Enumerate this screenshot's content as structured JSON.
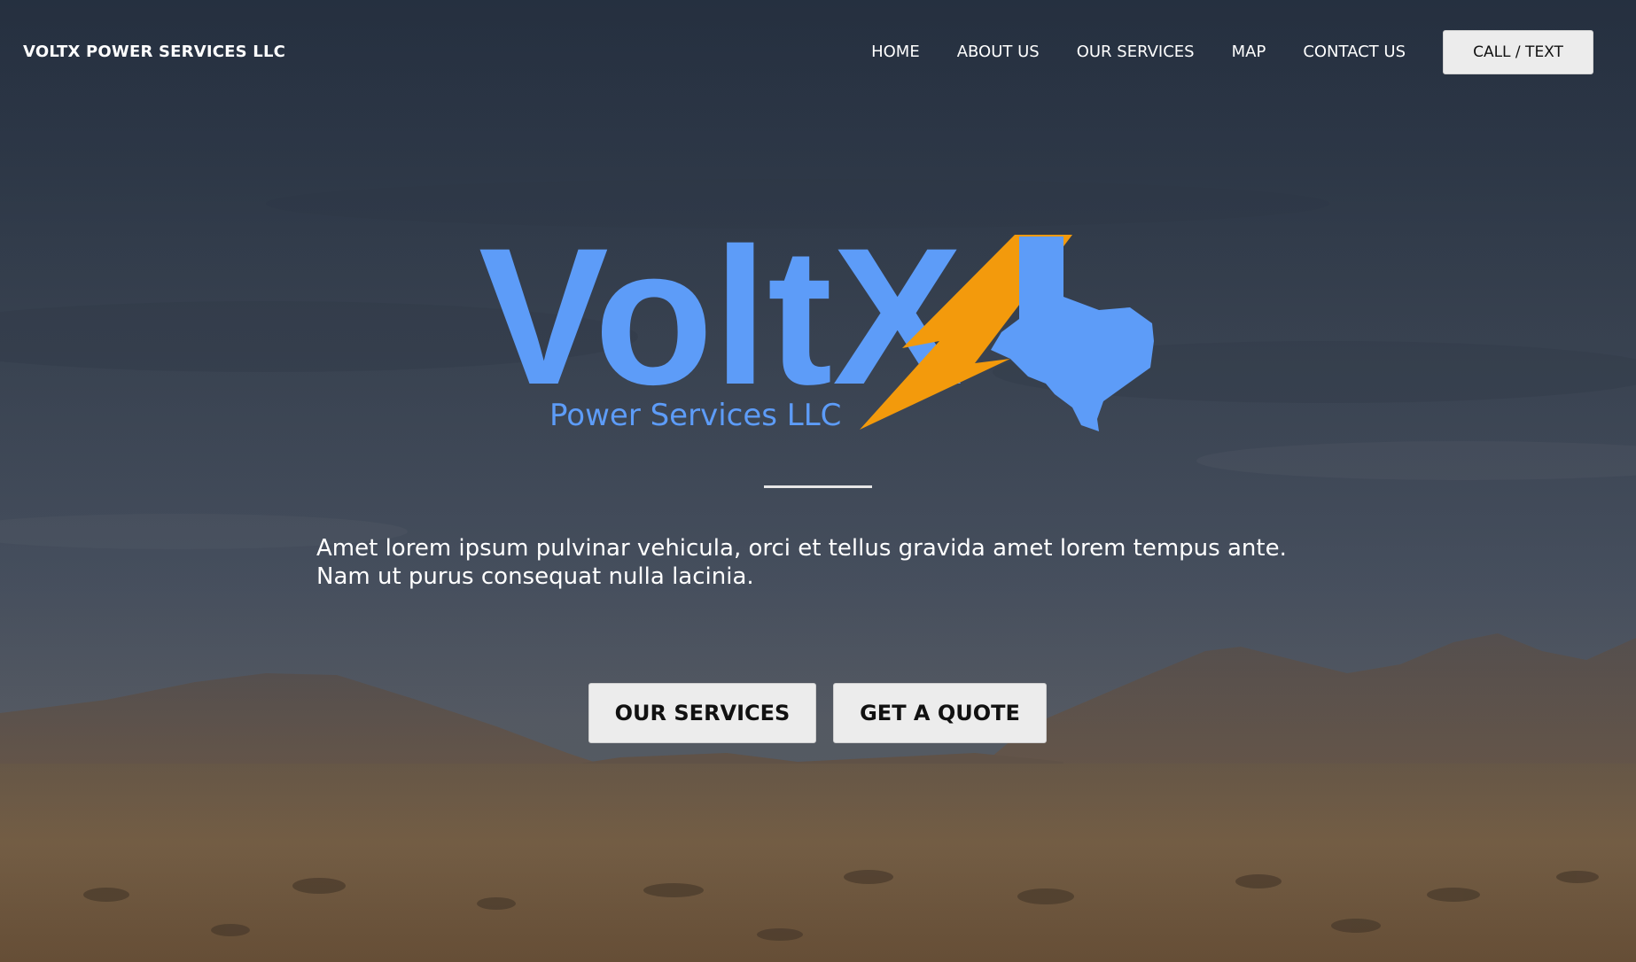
{
  "header": {
    "brand": "VOLTX POWER SERVICES LLC",
    "nav": [
      "HOME",
      "ABOUT US",
      "OUR SERVICES",
      "MAP",
      "CONTACT US"
    ],
    "call_label": "CALL / TEXT"
  },
  "hero": {
    "logo_word": "VoltX",
    "logo_subtitle": "Power Services LLC",
    "tagline": "Amet lorem ipsum pulvinar vehicula, orci et tellus gravida amet lorem tempus ante. Nam ut purus consequat nulla lacinia.",
    "buttons": {
      "services": "OUR SERVICES",
      "quote": "GET A QUOTE"
    }
  },
  "colors": {
    "logo_blue": "#5d9cf8",
    "bolt_orange": "#f39a0c",
    "button_bg": "#ececec"
  },
  "icons": {
    "bolt": "lightning-bolt-icon",
    "state": "texas-map-icon"
  }
}
